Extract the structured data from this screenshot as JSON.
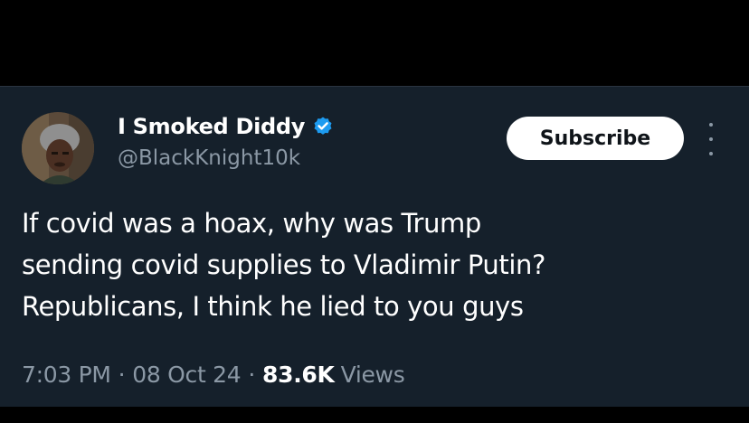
{
  "tweet": {
    "author": {
      "display_name": "I Smoked Diddy",
      "handle": "@BlackKnight10k",
      "verified": true,
      "verified_badge_color": "#1d9bf0"
    },
    "subscribe_label": "Subscribe",
    "more_icon": "more-vertical-icon",
    "text_lines": [
      "If covid was a hoax, why was Trump",
      "sending covid supplies to Vladimir Putin?",
      "Republicans, I think he lied to you guys"
    ],
    "meta": {
      "time": "7:03 PM",
      "separator": "·",
      "date": "08 Oct 24",
      "views_count": "83.6K",
      "views_label": "Views"
    }
  },
  "colors": {
    "card_background": "#15202b",
    "page_background": "#000000",
    "primary_text": "#ffffff",
    "secondary_text": "#8b98a5",
    "subscribe_button_bg": "#ffffff",
    "subscribe_button_text": "#0f1419"
  }
}
